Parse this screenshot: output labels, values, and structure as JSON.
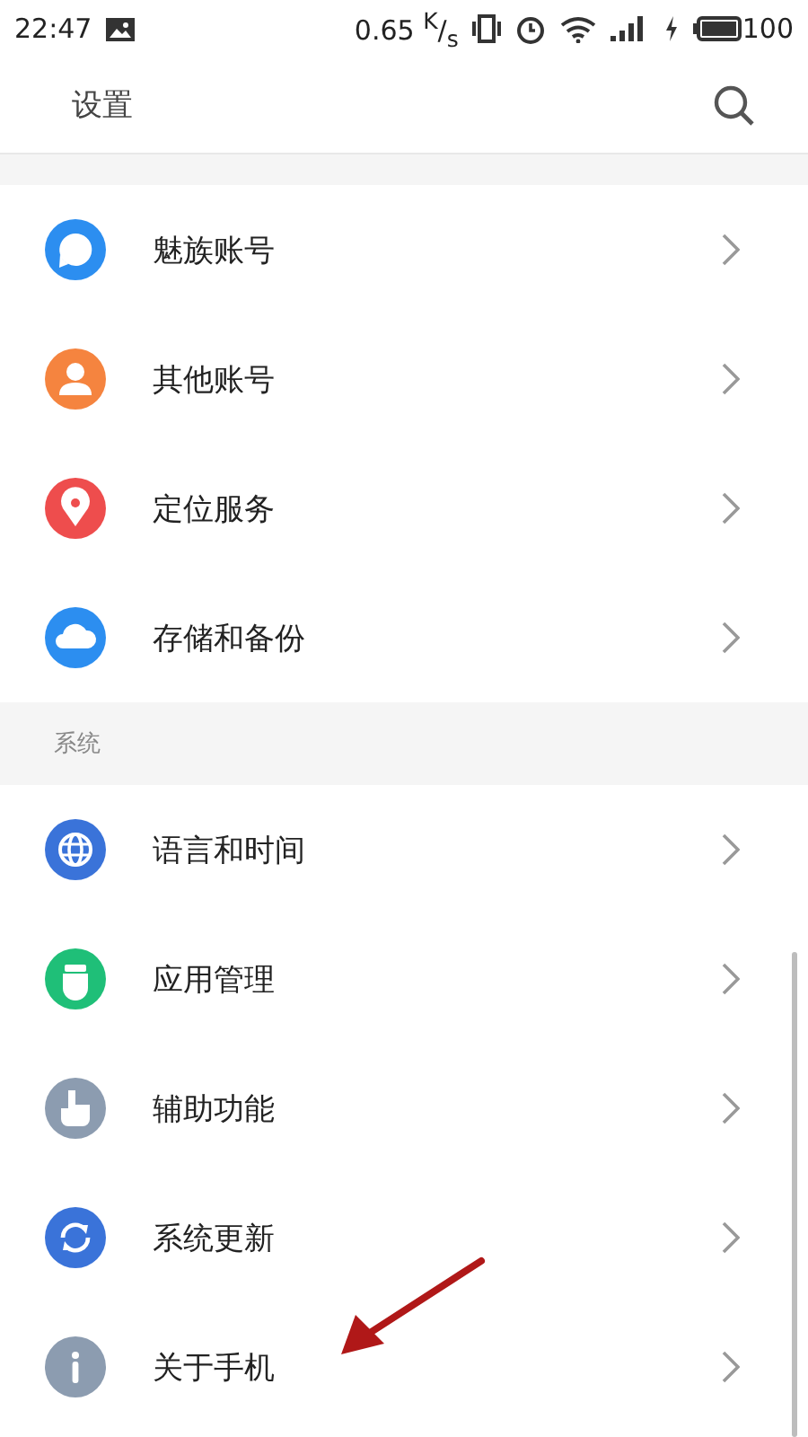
{
  "status_bar": {
    "time": "22:47",
    "speed": "0.65 $^{K}$/$_{s}$",
    "battery": "100"
  },
  "header": {
    "title": "设置"
  },
  "groups": [
    {
      "items": [
        {
          "label": "魅族账号",
          "kind": "account",
          "color": "#2c8ef0"
        },
        {
          "label": "其他账号",
          "kind": "person",
          "color": "#f5843f"
        },
        {
          "label": "定位服务",
          "kind": "location",
          "color": "#ee4d4d"
        },
        {
          "label": "存储和备份",
          "kind": "cloud",
          "color": "#2c8ef0"
        }
      ]
    },
    {
      "title": "系统",
      "items": [
        {
          "label": "语言和时间",
          "kind": "globe",
          "color": "#3a73d9"
        },
        {
          "label": "应用管理",
          "kind": "robot",
          "color": "#1fbf78"
        },
        {
          "label": "辅助功能",
          "kind": "hand",
          "color": "#8c9cb0"
        },
        {
          "label": "系统更新",
          "kind": "sync",
          "color": "#3a73d9"
        },
        {
          "label": "关于手机",
          "kind": "info",
          "color": "#8c9cb0"
        }
      ]
    }
  ]
}
